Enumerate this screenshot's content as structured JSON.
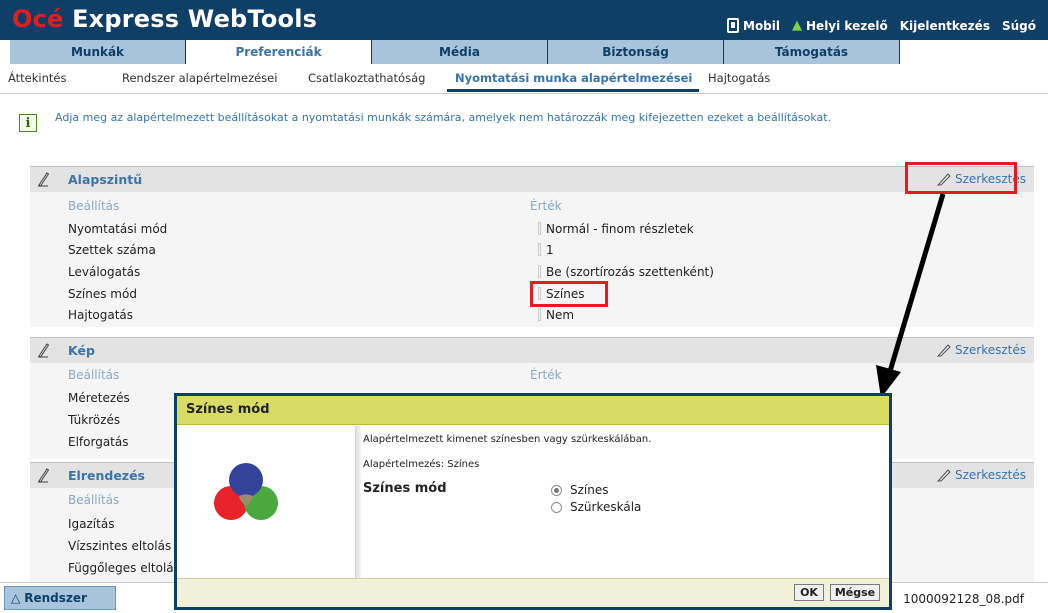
{
  "app": {
    "brand": "Océ",
    "title": " Express WebTools"
  },
  "toplinks": {
    "mobile": "Mobil",
    "local_operator": "Helyi kezelő",
    "logout": "Kijelentkezés",
    "help": "Súgó"
  },
  "main_tabs": [
    {
      "label": "Munkák",
      "active": false
    },
    {
      "label": "Preferenciák",
      "active": true
    },
    {
      "label": "Média",
      "active": false
    },
    {
      "label": "Biztonság",
      "active": false
    },
    {
      "label": "Támogatás",
      "active": false
    }
  ],
  "sub_tabs": [
    {
      "label": "Áttekintés",
      "active": false
    },
    {
      "label": "Rendszer alapértelmezései",
      "active": false
    },
    {
      "label": "Csatlakoztathatóság",
      "active": false
    },
    {
      "label": "Nyomtatási munka alapértelmezései",
      "active": true
    },
    {
      "label": "Hajtogatás",
      "active": false
    }
  ],
  "info": {
    "icon": "info-icon",
    "text": "Adja meg az alapértelmezett beállításokat a nyomtatási munkák számára, amelyek nem határozzák meg kifejezetten ezeket a beállításokat."
  },
  "edit_label": "Szerkesztés",
  "column_setting": "Beállítás",
  "column_value": "Érték",
  "sections": [
    {
      "title": "Alapszintű",
      "rows": [
        {
          "label": "Nyomtatási mód",
          "value": "Normál - finom részletek"
        },
        {
          "label": "Szettek száma",
          "value": "1"
        },
        {
          "label": "Leválogatás",
          "value": "Be (szortírozás szettenként)"
        },
        {
          "label": "Színes mód",
          "value": "Színes"
        },
        {
          "label": "Hajtogatás",
          "value": "Nem"
        }
      ]
    },
    {
      "title": "Kép",
      "rows": [
        {
          "label": "Méretezés"
        },
        {
          "label": "Tükrözés"
        },
        {
          "label": "Elforgatás"
        }
      ]
    },
    {
      "title": "Elrendezés",
      "rows": [
        {
          "label": "Igazítás"
        },
        {
          "label": "Vízszintes eltolás"
        },
        {
          "label": "Függőleges eltolás"
        }
      ]
    }
  ],
  "bottom": {
    "system_tab": "Rendszer",
    "filename": "1000092128_08.pdf"
  },
  "dialog": {
    "title": "Színes mód",
    "description": "Alapértelmezett kimenet színesben vagy szürkeskálában.",
    "default_text": "Alapértelmezés: Színes",
    "field_label": "Színes mód",
    "options": [
      {
        "label": "Színes",
        "checked": true
      },
      {
        "label": "Szürkeskála",
        "checked": false
      }
    ],
    "ok": "OK",
    "cancel": "Mégse"
  },
  "colors": {
    "header": "#0f3f66",
    "accent": "#3a74a8",
    "highlight": "#e31b23",
    "dialog_title": "#d9dc64"
  }
}
